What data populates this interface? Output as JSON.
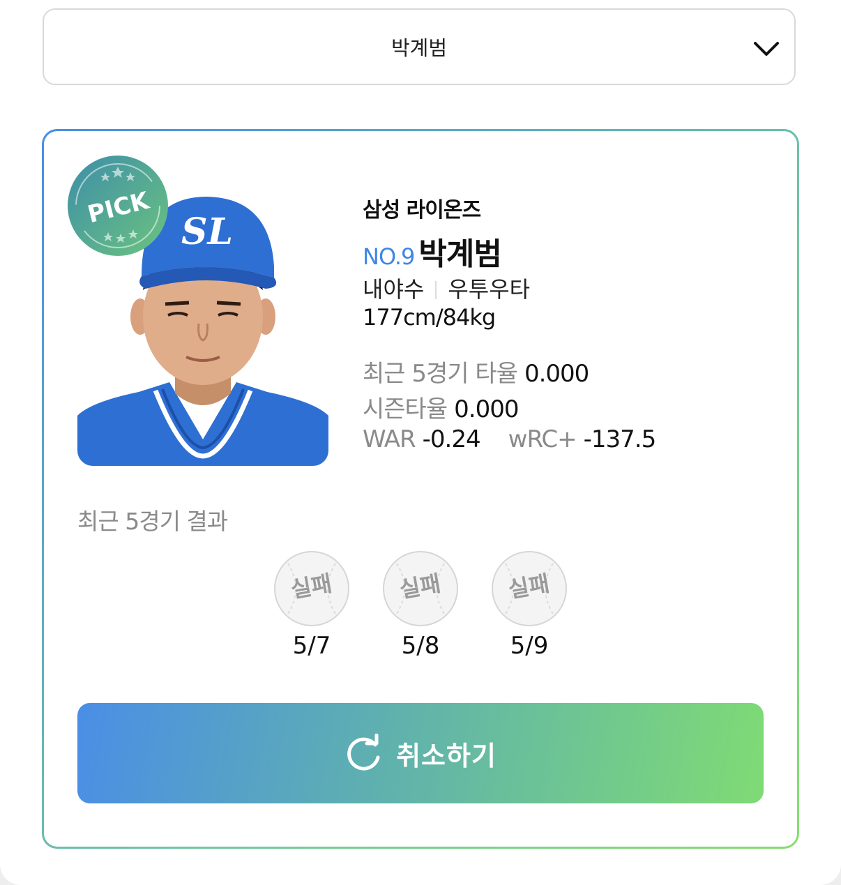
{
  "selector": {
    "value": "박계범",
    "icon": "chevron-down-icon"
  },
  "player": {
    "team": "삼성 라이온즈",
    "number": "NO.9",
    "name": "박계범",
    "position": "내야수",
    "bats_throws": "우투우타",
    "body": "177cm/84kg",
    "badge": "PICK",
    "cap_logo": "SL"
  },
  "stats": {
    "recent5_label": "최근 5경기 타율",
    "recent5_value": "0.000",
    "season_label": "시즌타율",
    "season_value": "0.000",
    "war_label": "WAR",
    "war_value": "-0.24",
    "wrc_label": "wRC+",
    "wrc_value": "-137.5"
  },
  "recent_results": {
    "title": "최근 5경기 결과",
    "games": [
      {
        "result": "실패",
        "date": "5/7"
      },
      {
        "result": "실패",
        "date": "5/8"
      },
      {
        "result": "실패",
        "date": "5/9"
      }
    ]
  },
  "cancel_button": {
    "label": "취소하기",
    "icon": "refresh-icon"
  },
  "colors": {
    "accent_blue": "#3f86e6",
    "gradient_start": "#4a8ee6",
    "gradient_end": "#7fdb74",
    "muted_text": "#8a8a8a"
  }
}
